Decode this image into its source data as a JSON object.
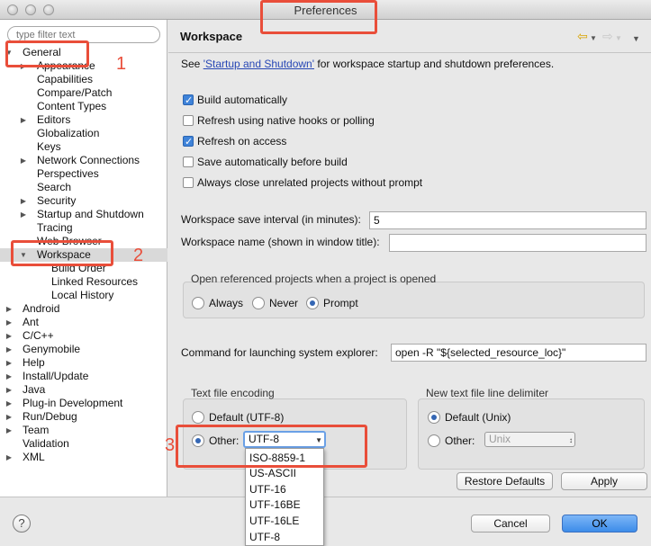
{
  "window": {
    "title": "Preferences"
  },
  "filter": {
    "placeholder": "type filter text"
  },
  "tree": [
    {
      "label": "General",
      "depth": 0,
      "arrow": "open"
    },
    {
      "label": "Appearance",
      "depth": 1,
      "arrow": "closed"
    },
    {
      "label": "Capabilities",
      "depth": 1,
      "arrow": "none"
    },
    {
      "label": "Compare/Patch",
      "depth": 1,
      "arrow": "none"
    },
    {
      "label": "Content Types",
      "depth": 1,
      "arrow": "none"
    },
    {
      "label": "Editors",
      "depth": 1,
      "arrow": "closed"
    },
    {
      "label": "Globalization",
      "depth": 1,
      "arrow": "none"
    },
    {
      "label": "Keys",
      "depth": 1,
      "arrow": "none"
    },
    {
      "label": "Network Connections",
      "depth": 1,
      "arrow": "closed"
    },
    {
      "label": "Perspectives",
      "depth": 1,
      "arrow": "none"
    },
    {
      "label": "Search",
      "depth": 1,
      "arrow": "none"
    },
    {
      "label": "Security",
      "depth": 1,
      "arrow": "closed"
    },
    {
      "label": "Startup and Shutdown",
      "depth": 1,
      "arrow": "closed"
    },
    {
      "label": "Tracing",
      "depth": 1,
      "arrow": "none"
    },
    {
      "label": "Web Browser",
      "depth": 1,
      "arrow": "none"
    },
    {
      "label": "Workspace",
      "depth": 1,
      "arrow": "open",
      "selected": true
    },
    {
      "label": "Build Order",
      "depth": 2,
      "arrow": "none"
    },
    {
      "label": "Linked Resources",
      "depth": 2,
      "arrow": "none"
    },
    {
      "label": "Local History",
      "depth": 2,
      "arrow": "none"
    },
    {
      "label": "Android",
      "depth": 0,
      "arrow": "closed"
    },
    {
      "label": "Ant",
      "depth": 0,
      "arrow": "closed"
    },
    {
      "label": "C/C++",
      "depth": 0,
      "arrow": "closed"
    },
    {
      "label": "Genymobile",
      "depth": 0,
      "arrow": "closed"
    },
    {
      "label": "Help",
      "depth": 0,
      "arrow": "closed"
    },
    {
      "label": "Install/Update",
      "depth": 0,
      "arrow": "closed"
    },
    {
      "label": "Java",
      "depth": 0,
      "arrow": "closed"
    },
    {
      "label": "Plug-in Development",
      "depth": 0,
      "arrow": "closed"
    },
    {
      "label": "Run/Debug",
      "depth": 0,
      "arrow": "closed"
    },
    {
      "label": "Team",
      "depth": 0,
      "arrow": "closed"
    },
    {
      "label": "Validation",
      "depth": 0,
      "arrow": "none"
    },
    {
      "label": "XML",
      "depth": 0,
      "arrow": "closed"
    }
  ],
  "page": {
    "title": "Workspace",
    "intro_prefix": "See ",
    "intro_link": "'Startup and Shutdown'",
    "intro_suffix": " for workspace startup and shutdown preferences."
  },
  "checkboxes": [
    {
      "label": "Build automatically",
      "checked": true
    },
    {
      "label": "Refresh using native hooks or polling",
      "checked": false
    },
    {
      "label": "Refresh on access",
      "checked": true
    },
    {
      "label": "Save automatically before build",
      "checked": false
    },
    {
      "label": "Always close unrelated projects without prompt",
      "checked": false
    }
  ],
  "fields": {
    "save_interval_label": "Workspace save interval (in minutes):",
    "save_interval_value": "5",
    "workspace_name_label": "Workspace name (shown in window title):",
    "workspace_name_value": "",
    "explorer_label": "Command for launching system explorer:",
    "explorer_value": "open -R \"${selected_resource_loc}\""
  },
  "open_projects": {
    "title": "Open referenced projects when a project is opened",
    "options": [
      "Always",
      "Never",
      "Prompt"
    ],
    "selected": "Prompt"
  },
  "encoding": {
    "title": "Text file encoding",
    "default_label": "Default (UTF-8)",
    "other_label": "Other:",
    "other_value": "UTF-8",
    "selected": "Other",
    "dropdown_options": [
      "ISO-8859-1",
      "US-ASCII",
      "UTF-16",
      "UTF-16BE",
      "UTF-16LE",
      "UTF-8"
    ]
  },
  "line_delimiter": {
    "title": "New text file line delimiter",
    "default_label": "Default (Unix)",
    "other_label": "Other:",
    "other_value": "Unix",
    "selected": "Default"
  },
  "buttons": {
    "restore_defaults": "Restore Defaults",
    "apply": "Apply",
    "cancel": "Cancel",
    "ok": "OK",
    "help": "?"
  },
  "annotations": [
    "1",
    "2",
    "3"
  ],
  "colors": {
    "annotation": "#e94e3a",
    "link": "#2747b5",
    "primary_button": "#3c8ce9"
  }
}
